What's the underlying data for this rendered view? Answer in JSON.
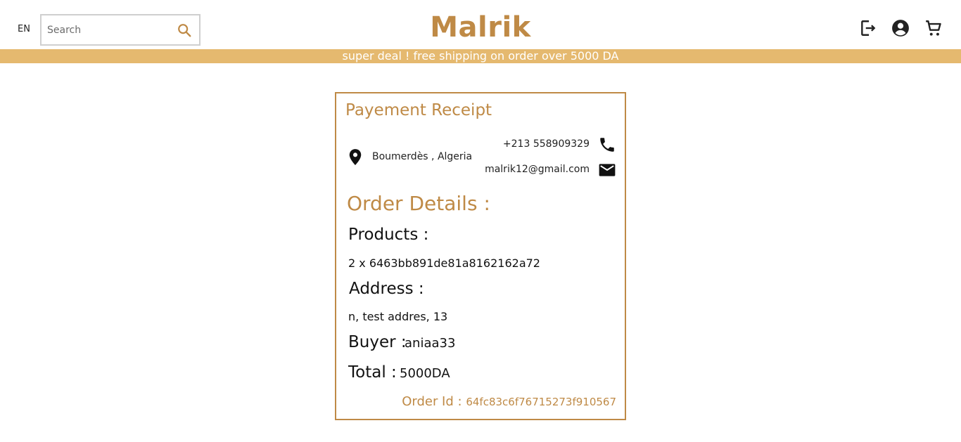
{
  "header": {
    "lang": "EN",
    "search_placeholder": "Search",
    "logo": "Malrik",
    "icons": [
      "logout-icon",
      "account-icon",
      "cart-icon"
    ]
  },
  "banner": {
    "text": "super deal ! free shipping on order over 5000 DA"
  },
  "receipt": {
    "title": "Payement Receipt",
    "location": "Boumerdès , Algeria",
    "phone": "+213 558909329",
    "email": "malrik12@gmail.com",
    "order_details_heading": "Order Details :",
    "products_label": "Products :",
    "products_value": "2 x 6463bb891de81a8162162a72",
    "address_label": "Address :",
    "address_value": "n, test addres, 13",
    "buyer_label": "Buyer :",
    "buyer_value": "aniaa33",
    "total_label": "Total :",
    "total_value": "5000DA",
    "order_id_label": "Order Id :",
    "order_id_value": "64fc83c6f76715273f910567"
  },
  "colors": {
    "accent": "#bf8a46",
    "banner": "#e5b96f"
  }
}
